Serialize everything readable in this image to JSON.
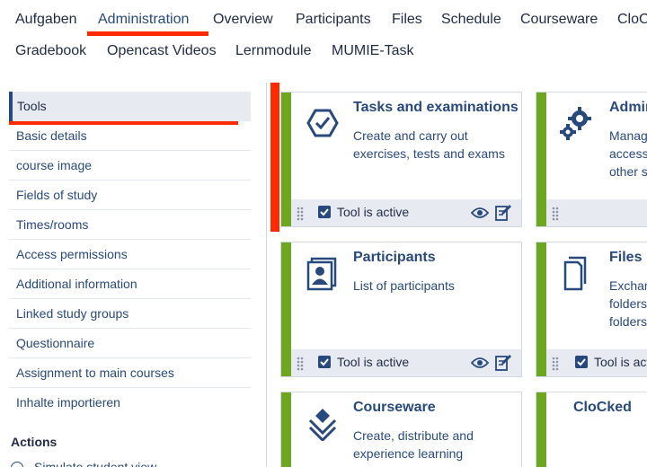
{
  "nav": {
    "row1": [
      "Aufgaben",
      "Administration",
      "Overview",
      "Participants",
      "Files",
      "Schedule",
      "Courseware",
      "CloC"
    ],
    "row2": [
      "Gradebook",
      "Opencast Videos",
      "Lernmodule",
      "MUMIE-Task"
    ],
    "active": "Administration"
  },
  "sidebar": {
    "items": [
      "Tools",
      "Basic details",
      "course image",
      "Fields of study",
      "Times/rooms",
      "Access permissions",
      "Additional information",
      "Linked study groups",
      "Questionnaire",
      "Assignment to main courses",
      "Inhalte importieren"
    ],
    "active": "Tools",
    "actions_title": "Actions",
    "actions_item": "Simulate student view"
  },
  "cards": [
    {
      "title": "Tasks and examinations",
      "desc": "Create and carry out exercises, tests and exams",
      "footer": "Tool is active",
      "icon": "tasks-icon"
    },
    {
      "title": "Admin",
      "desc": "Manag access other s",
      "footer": "",
      "icon": "gears-icon"
    },
    {
      "title": "Participants",
      "desc": "List of participants",
      "footer": "Tool is active",
      "icon": "participants-icon"
    },
    {
      "title": "Files",
      "desc": "Exchan folders folders",
      "footer": "Tool is acti",
      "icon": "files-icon"
    },
    {
      "title": "Courseware",
      "desc": "Create, distribute and experience learning",
      "footer": "",
      "icon": "courseware-icon"
    },
    {
      "title": "CloCked",
      "desc": "",
      "footer": "",
      "icon": ""
    }
  ],
  "colors": {
    "accent": "#28497c",
    "green": "#6ea620",
    "annotation": "#ff2a00"
  }
}
